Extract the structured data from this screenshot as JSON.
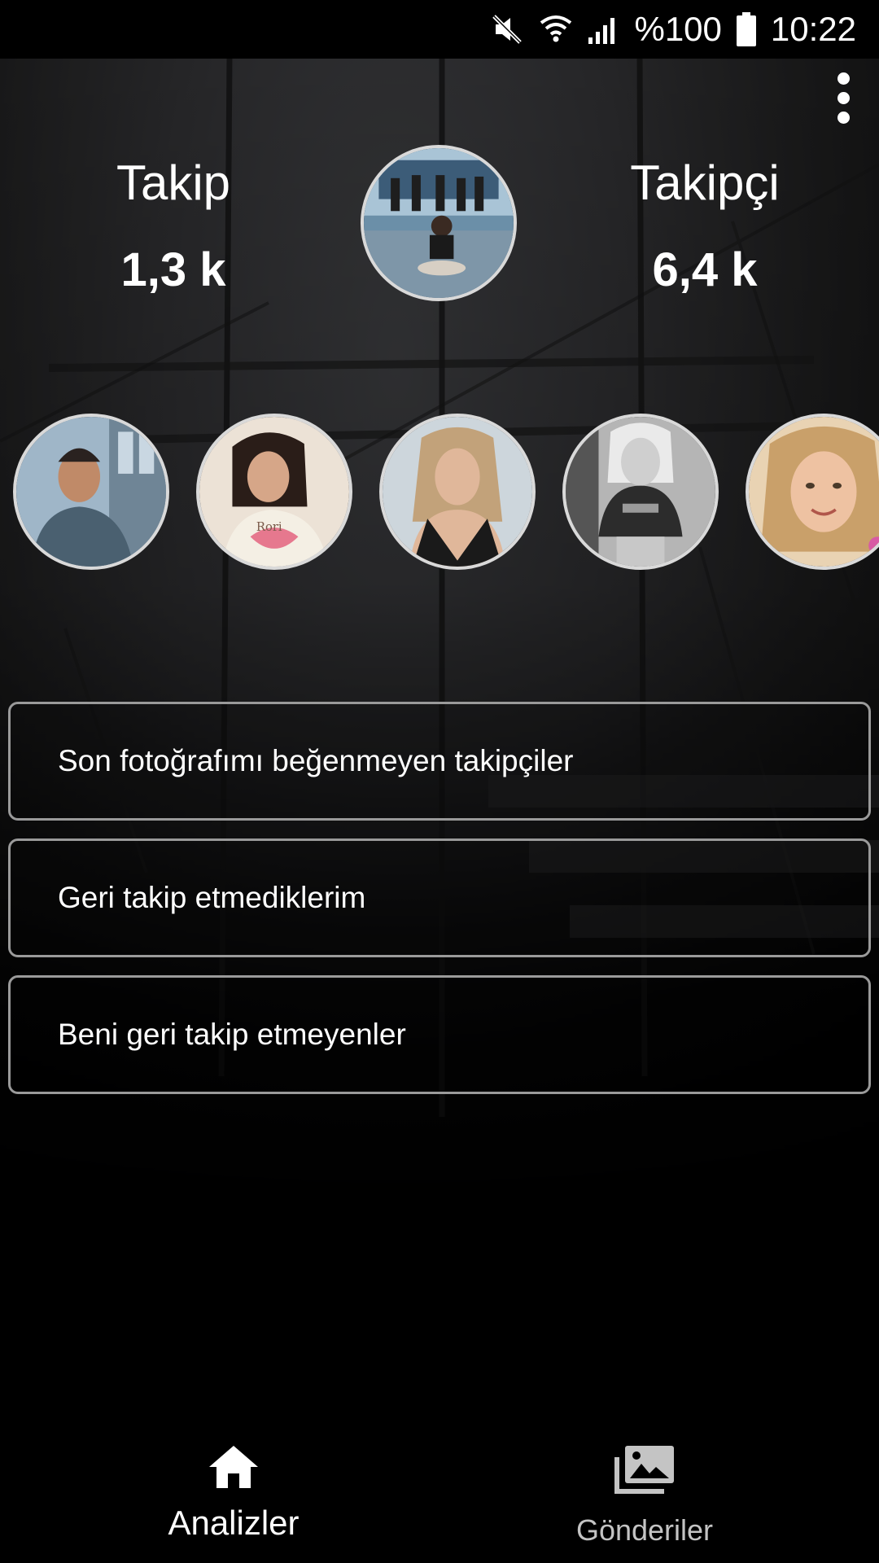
{
  "status_bar": {
    "battery": "%100",
    "time": "10:22",
    "icons": [
      "mute-icon",
      "wifi-icon",
      "signal-icon",
      "battery-icon"
    ]
  },
  "menu": {
    "icon": "more-vert-icon"
  },
  "stats": {
    "following_label": "Takip",
    "following_value": "1,3 k",
    "followers_label": "Takipçi",
    "followers_value": "6,4 k"
  },
  "options": [
    {
      "label": "Son fotoğrafımı beğenmeyen takipçiler"
    },
    {
      "label": "Geri takip etmediklerim"
    },
    {
      "label": "Beni geri takip etmeyenler"
    }
  ],
  "bottom_nav": {
    "items": [
      {
        "label": "Analizler",
        "icon": "home-icon",
        "active": true
      },
      {
        "label": "Gönderiler",
        "icon": "photo-library-icon",
        "active": false
      }
    ]
  },
  "colors": {
    "background": "#000000",
    "text": "#ffffff",
    "border": "#9a9a9a",
    "inactive_nav": "#c4c4c4"
  }
}
